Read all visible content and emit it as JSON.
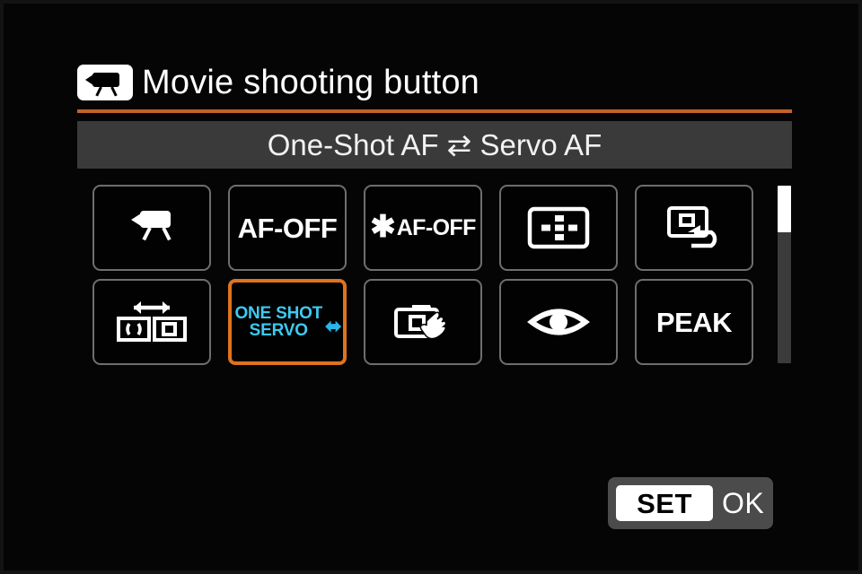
{
  "screen": {
    "background_color": "#050505",
    "accent_color": "#c4622a",
    "selection_color": "#e0731f",
    "highlight_text_color": "#3ec9f0"
  },
  "header": {
    "icon": "movie-camera-icon",
    "title": "Movie shooting button"
  },
  "subtitle": {
    "text": "One-Shot AF ⇄ Servo AF"
  },
  "options": [
    {
      "id": "movie-shooting",
      "icon": "movie-camera-icon",
      "label": "",
      "selected": false,
      "row": 1,
      "column": 1
    },
    {
      "id": "af-off",
      "icon": "af-off-text-icon",
      "label": "AF-OFF",
      "selected": false,
      "row": 1,
      "column": 2
    },
    {
      "id": "ae-lock-af-off",
      "icon": "ae-lock-af-off-icon",
      "star": "✱",
      "label": "AF-OFF",
      "selected": false,
      "row": 1,
      "column": 3
    },
    {
      "id": "af-point-selection",
      "icon": "af-point-grid-icon",
      "label": "",
      "selected": false,
      "row": 1,
      "column": 4
    },
    {
      "id": "image-replay",
      "icon": "image-replay-icon",
      "label": "",
      "selected": false,
      "row": 1,
      "column": 5
    },
    {
      "id": "af-area-switch",
      "icon": "af-area-switch-icon",
      "label": "",
      "selected": false,
      "row": 2,
      "column": 1
    },
    {
      "id": "one-shot-servo",
      "icon": "one-shot-servo-icon",
      "label_line1": "ONE SHOT",
      "label_line2": "SERVO",
      "arrow": "⬌",
      "selected": true,
      "row": 2,
      "column": 2
    },
    {
      "id": "registered-function",
      "icon": "camera-hand-icon",
      "label": "",
      "selected": false,
      "row": 2,
      "column": 3
    },
    {
      "id": "eye-detection",
      "icon": "eye-icon",
      "label": "",
      "selected": false,
      "row": 2,
      "column": 4
    },
    {
      "id": "peaking",
      "icon": "peak-text-icon",
      "label": "PEAK",
      "selected": false,
      "row": 2,
      "column": 5
    }
  ],
  "scrollbar": {
    "thumb_position_percent": 0,
    "thumb_size_percent": 26
  },
  "footer": {
    "set_label": "SET",
    "ok_label": "OK"
  }
}
